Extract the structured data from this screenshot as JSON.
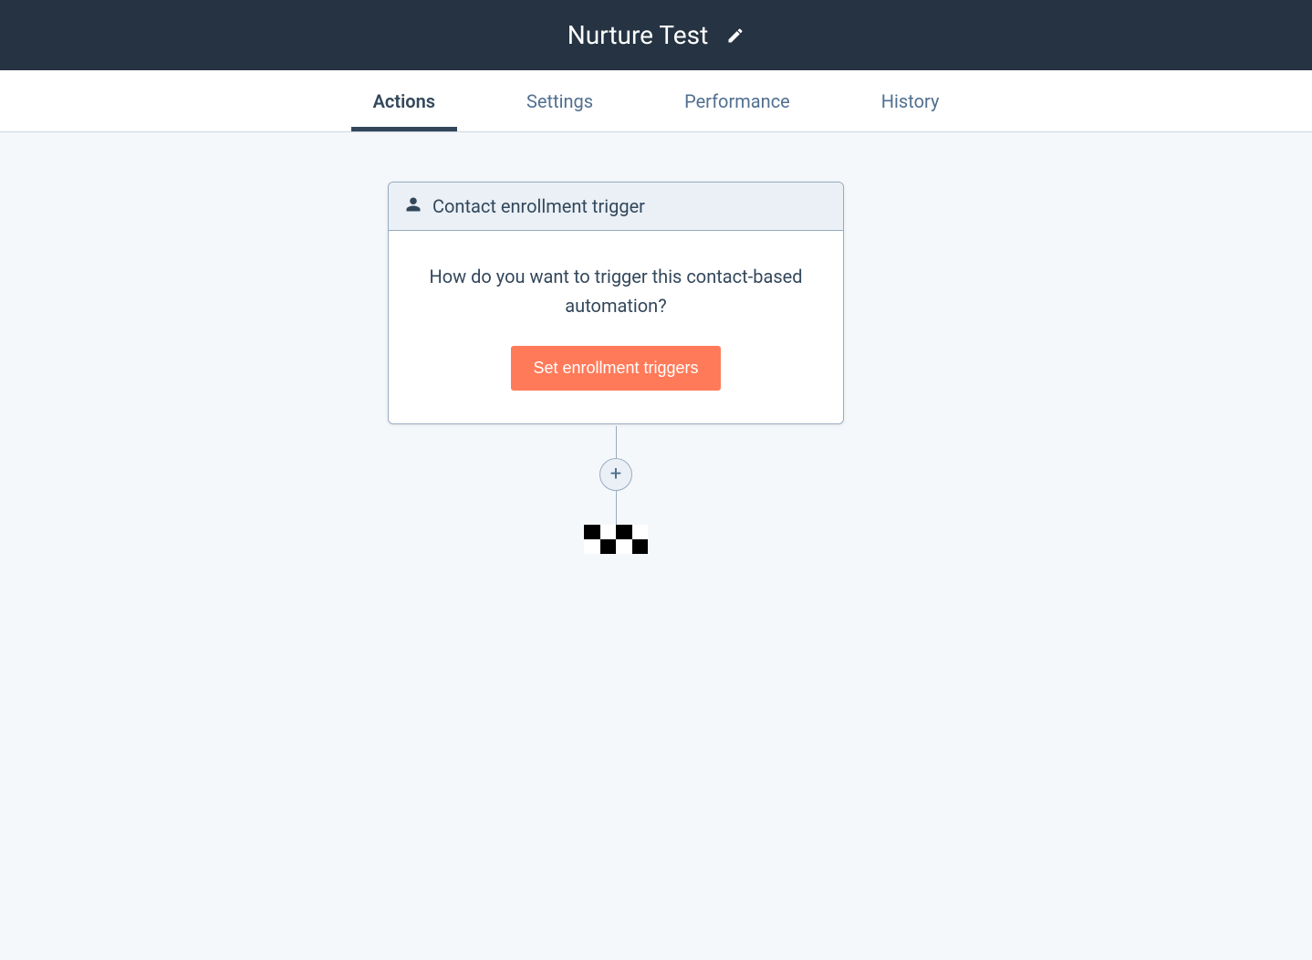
{
  "header": {
    "title": "Nurture Test"
  },
  "tabs": [
    {
      "label": "Actions",
      "active": true
    },
    {
      "label": "Settings",
      "active": false
    },
    {
      "label": "Performance",
      "active": false
    },
    {
      "label": "History",
      "active": false
    }
  ],
  "trigger_card": {
    "title": "Contact enrollment trigger",
    "question": "How do you want to trigger this contact-based automation?",
    "button_label": "Set enrollment triggers"
  }
}
